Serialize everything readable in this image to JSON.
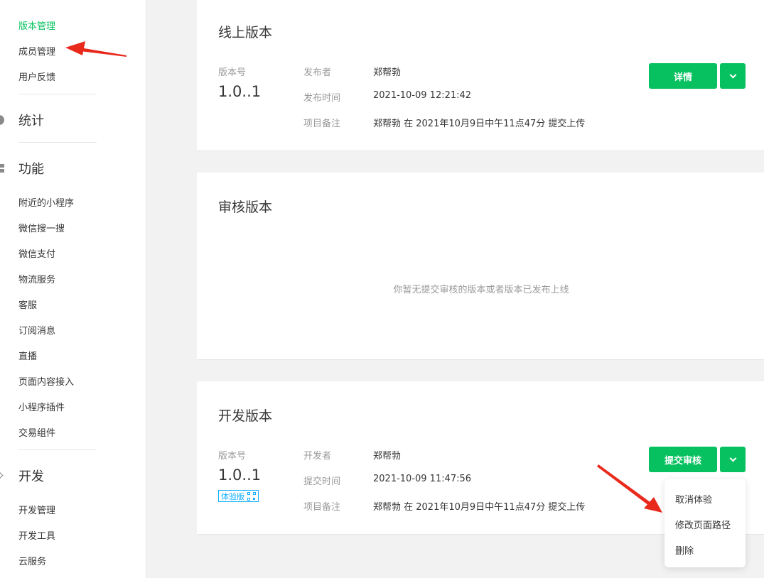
{
  "sidebar": {
    "top_items": [
      {
        "label": "版本管理",
        "active": true
      },
      {
        "label": "成员管理"
      },
      {
        "label": "用户反馈"
      }
    ],
    "stats_section": {
      "label": "统计",
      "icon": "pie-chart-icon"
    },
    "features_section": {
      "label": "功能",
      "icon": "grid-icon"
    },
    "feature_items": [
      "附近的小程序",
      "微信搜一搜",
      "微信支付",
      "物流服务",
      "客服",
      "订阅消息",
      "直播",
      "页面内容接入",
      "小程序插件",
      "交易组件"
    ],
    "dev_section": {
      "label": "开发",
      "icon": "code-icon"
    },
    "dev_items": [
      "开发管理",
      "开发工具",
      "云服务"
    ]
  },
  "online": {
    "title": "线上版本",
    "version_label": "版本号",
    "version": "1.0..1",
    "publisher_label": "发布者",
    "publisher": "郑帮勃",
    "time_label": "发布时间",
    "time": "2021-10-09 12:21:42",
    "note_label": "项目备注",
    "note": "郑帮勃 在 2021年10月9日中午11点47分 提交上传",
    "button": "详情"
  },
  "review": {
    "title": "审核版本",
    "empty": "你暂无提交审核的版本或者版本已发布上线"
  },
  "dev": {
    "title": "开发版本",
    "version_label": "版本号",
    "version": "1.0..1",
    "badge": "体验版",
    "developer_label": "开发者",
    "developer": "郑帮勃",
    "time_label": "提交时间",
    "time": "2021-10-09 11:47:56",
    "note_label": "项目备注",
    "note": "郑帮勃 在 2021年10月9日中午11点47分 提交上传",
    "button": "提交审核",
    "dropdown": [
      "取消体验",
      "修改页面路径",
      "删除"
    ]
  },
  "colors": {
    "accent": "#07c160",
    "arrow": "#e8291c",
    "badge": "#10aeff"
  }
}
